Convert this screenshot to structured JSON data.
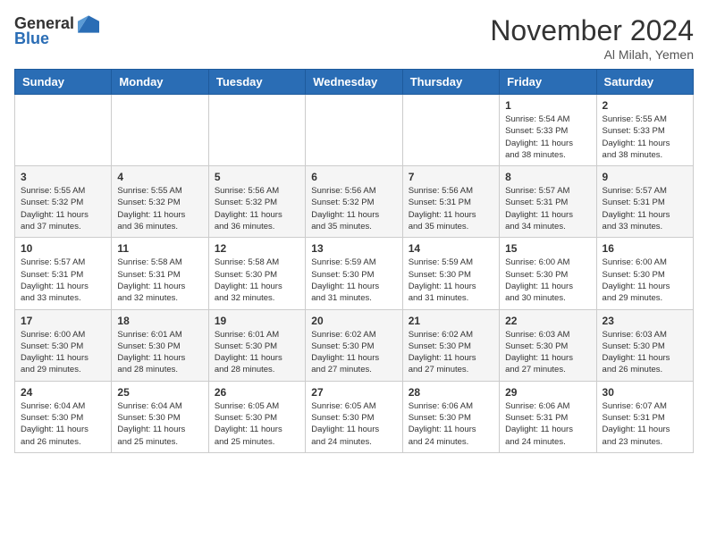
{
  "header": {
    "logo_general": "General",
    "logo_blue": "Blue",
    "month": "November 2024",
    "location": "Al Milah, Yemen"
  },
  "days_of_week": [
    "Sunday",
    "Monday",
    "Tuesday",
    "Wednesday",
    "Thursday",
    "Friday",
    "Saturday"
  ],
  "weeks": [
    [
      {
        "day": "",
        "info": ""
      },
      {
        "day": "",
        "info": ""
      },
      {
        "day": "",
        "info": ""
      },
      {
        "day": "",
        "info": ""
      },
      {
        "day": "",
        "info": ""
      },
      {
        "day": "1",
        "info": "Sunrise: 5:54 AM\nSunset: 5:33 PM\nDaylight: 11 hours\nand 38 minutes."
      },
      {
        "day": "2",
        "info": "Sunrise: 5:55 AM\nSunset: 5:33 PM\nDaylight: 11 hours\nand 38 minutes."
      }
    ],
    [
      {
        "day": "3",
        "info": "Sunrise: 5:55 AM\nSunset: 5:32 PM\nDaylight: 11 hours\nand 37 minutes."
      },
      {
        "day": "4",
        "info": "Sunrise: 5:55 AM\nSunset: 5:32 PM\nDaylight: 11 hours\nand 36 minutes."
      },
      {
        "day": "5",
        "info": "Sunrise: 5:56 AM\nSunset: 5:32 PM\nDaylight: 11 hours\nand 36 minutes."
      },
      {
        "day": "6",
        "info": "Sunrise: 5:56 AM\nSunset: 5:32 PM\nDaylight: 11 hours\nand 35 minutes."
      },
      {
        "day": "7",
        "info": "Sunrise: 5:56 AM\nSunset: 5:31 PM\nDaylight: 11 hours\nand 35 minutes."
      },
      {
        "day": "8",
        "info": "Sunrise: 5:57 AM\nSunset: 5:31 PM\nDaylight: 11 hours\nand 34 minutes."
      },
      {
        "day": "9",
        "info": "Sunrise: 5:57 AM\nSunset: 5:31 PM\nDaylight: 11 hours\nand 33 minutes."
      }
    ],
    [
      {
        "day": "10",
        "info": "Sunrise: 5:57 AM\nSunset: 5:31 PM\nDaylight: 11 hours\nand 33 minutes."
      },
      {
        "day": "11",
        "info": "Sunrise: 5:58 AM\nSunset: 5:31 PM\nDaylight: 11 hours\nand 32 minutes."
      },
      {
        "day": "12",
        "info": "Sunrise: 5:58 AM\nSunset: 5:30 PM\nDaylight: 11 hours\nand 32 minutes."
      },
      {
        "day": "13",
        "info": "Sunrise: 5:59 AM\nSunset: 5:30 PM\nDaylight: 11 hours\nand 31 minutes."
      },
      {
        "day": "14",
        "info": "Sunrise: 5:59 AM\nSunset: 5:30 PM\nDaylight: 11 hours\nand 31 minutes."
      },
      {
        "day": "15",
        "info": "Sunrise: 6:00 AM\nSunset: 5:30 PM\nDaylight: 11 hours\nand 30 minutes."
      },
      {
        "day": "16",
        "info": "Sunrise: 6:00 AM\nSunset: 5:30 PM\nDaylight: 11 hours\nand 29 minutes."
      }
    ],
    [
      {
        "day": "17",
        "info": "Sunrise: 6:00 AM\nSunset: 5:30 PM\nDaylight: 11 hours\nand 29 minutes."
      },
      {
        "day": "18",
        "info": "Sunrise: 6:01 AM\nSunset: 5:30 PM\nDaylight: 11 hours\nand 28 minutes."
      },
      {
        "day": "19",
        "info": "Sunrise: 6:01 AM\nSunset: 5:30 PM\nDaylight: 11 hours\nand 28 minutes."
      },
      {
        "day": "20",
        "info": "Sunrise: 6:02 AM\nSunset: 5:30 PM\nDaylight: 11 hours\nand 27 minutes."
      },
      {
        "day": "21",
        "info": "Sunrise: 6:02 AM\nSunset: 5:30 PM\nDaylight: 11 hours\nand 27 minutes."
      },
      {
        "day": "22",
        "info": "Sunrise: 6:03 AM\nSunset: 5:30 PM\nDaylight: 11 hours\nand 27 minutes."
      },
      {
        "day": "23",
        "info": "Sunrise: 6:03 AM\nSunset: 5:30 PM\nDaylight: 11 hours\nand 26 minutes."
      }
    ],
    [
      {
        "day": "24",
        "info": "Sunrise: 6:04 AM\nSunset: 5:30 PM\nDaylight: 11 hours\nand 26 minutes."
      },
      {
        "day": "25",
        "info": "Sunrise: 6:04 AM\nSunset: 5:30 PM\nDaylight: 11 hours\nand 25 minutes."
      },
      {
        "day": "26",
        "info": "Sunrise: 6:05 AM\nSunset: 5:30 PM\nDaylight: 11 hours\nand 25 minutes."
      },
      {
        "day": "27",
        "info": "Sunrise: 6:05 AM\nSunset: 5:30 PM\nDaylight: 11 hours\nand 24 minutes."
      },
      {
        "day": "28",
        "info": "Sunrise: 6:06 AM\nSunset: 5:30 PM\nDaylight: 11 hours\nand 24 minutes."
      },
      {
        "day": "29",
        "info": "Sunrise: 6:06 AM\nSunset: 5:31 PM\nDaylight: 11 hours\nand 24 minutes."
      },
      {
        "day": "30",
        "info": "Sunrise: 6:07 AM\nSunset: 5:31 PM\nDaylight: 11 hours\nand 23 minutes."
      }
    ]
  ]
}
